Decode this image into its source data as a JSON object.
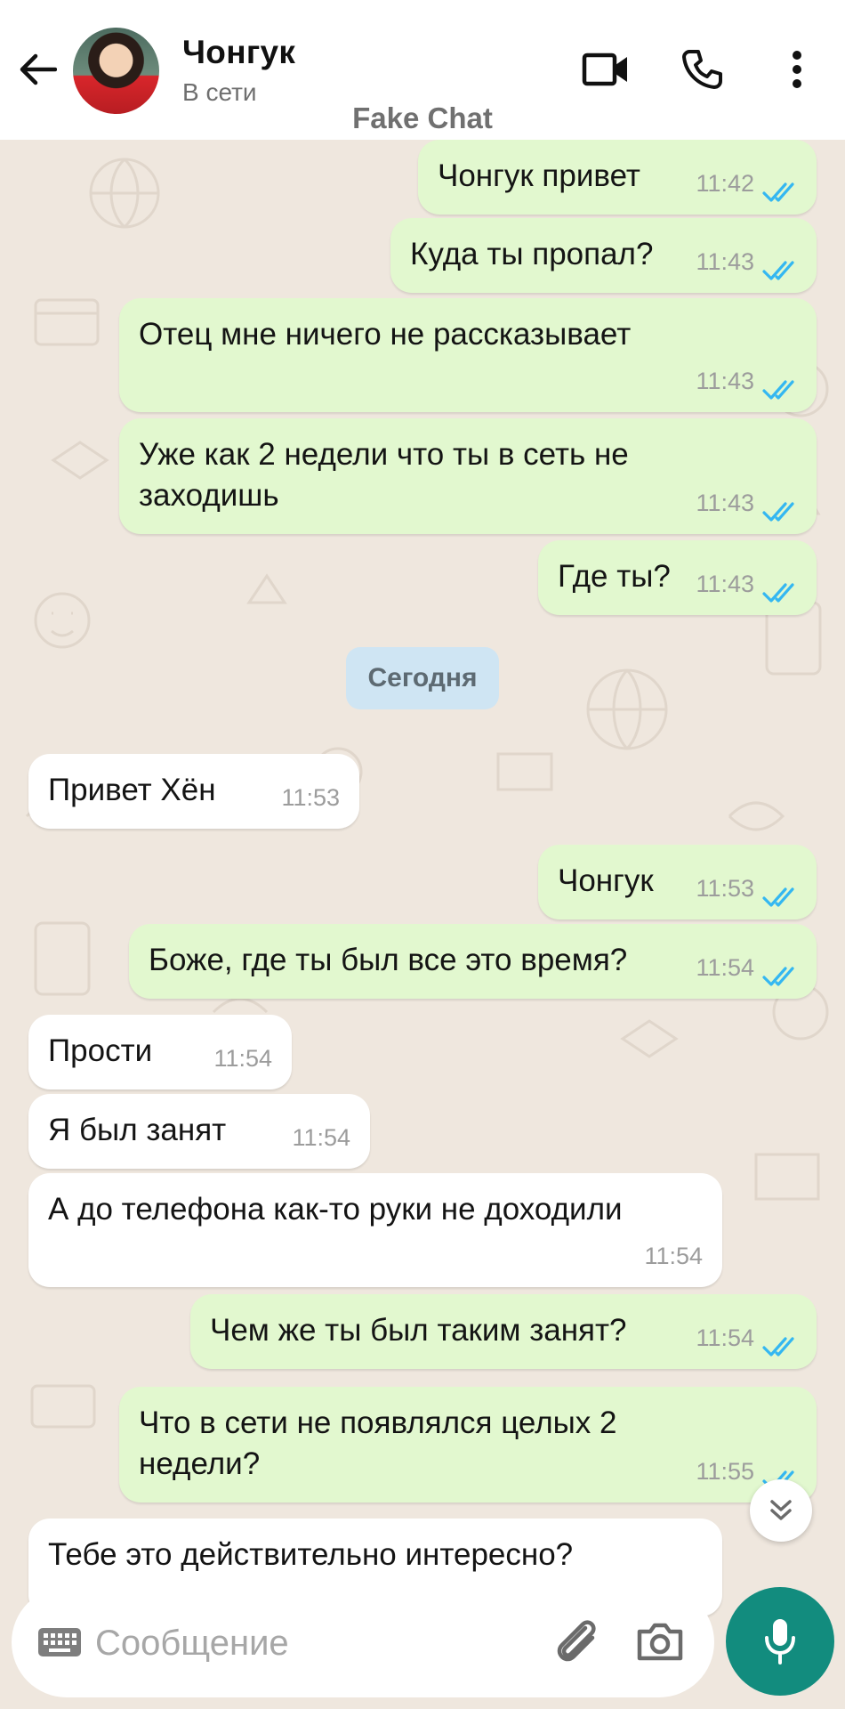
{
  "header": {
    "contact_name": "Чонгук",
    "contact_status": "В сети",
    "watermark": "Fake Chat",
    "icons": [
      "arrow-left-icon",
      "video-call-icon",
      "phone-icon",
      "more-vertical-icon"
    ]
  },
  "messages": [
    {
      "direction": "out",
      "text": "Чонгук привет",
      "time": "11:42",
      "status": "read"
    },
    {
      "direction": "out",
      "text": "Куда ты пропал?",
      "time": "11:43",
      "status": "read"
    },
    {
      "direction": "out",
      "text": "Отец мне ничего не рассказывает",
      "time": "11:43",
      "status": "read"
    },
    {
      "direction": "out",
      "text": "Уже как 2 недели что ты в сеть не заходишь",
      "time": "11:43",
      "status": "read"
    },
    {
      "direction": "out",
      "text": "Где ты?",
      "time": "11:43",
      "status": "read"
    },
    {
      "direction": "in",
      "text": "Привет Хён",
      "time": "11:53"
    },
    {
      "direction": "out",
      "text": "Чонгук",
      "time": "11:53",
      "status": "read"
    },
    {
      "direction": "out",
      "text": "Боже, где ты был все это время?",
      "time": "11:54",
      "status": "read"
    },
    {
      "direction": "in",
      "text": "Прости",
      "time": "11:54"
    },
    {
      "direction": "in",
      "text": "Я был занят",
      "time": "11:54"
    },
    {
      "direction": "in",
      "text": "А до телефона как-то руки не доходили",
      "time": "11:54"
    },
    {
      "direction": "out",
      "text": "Чем же ты был таким занят?",
      "time": "11:54",
      "status": "read"
    },
    {
      "direction": "out",
      "text": "Что в сети не появлялся целых 2 недели?",
      "time": "11:55",
      "status": "read"
    },
    {
      "direction": "in",
      "text": "Тебе это действительно интересно?",
      "time": ""
    }
  ],
  "date_divider": "Сегодня",
  "composer": {
    "placeholder": "Сообщение",
    "value": ""
  },
  "colors": {
    "outgoing_bubble": "#e2f8cf",
    "incoming_bubble": "#ffffff",
    "wallpaper": "#efe7de",
    "read_ticks": "#34b7f1",
    "accent": "#128c7e",
    "date_chip": "#cfe5f3"
  }
}
